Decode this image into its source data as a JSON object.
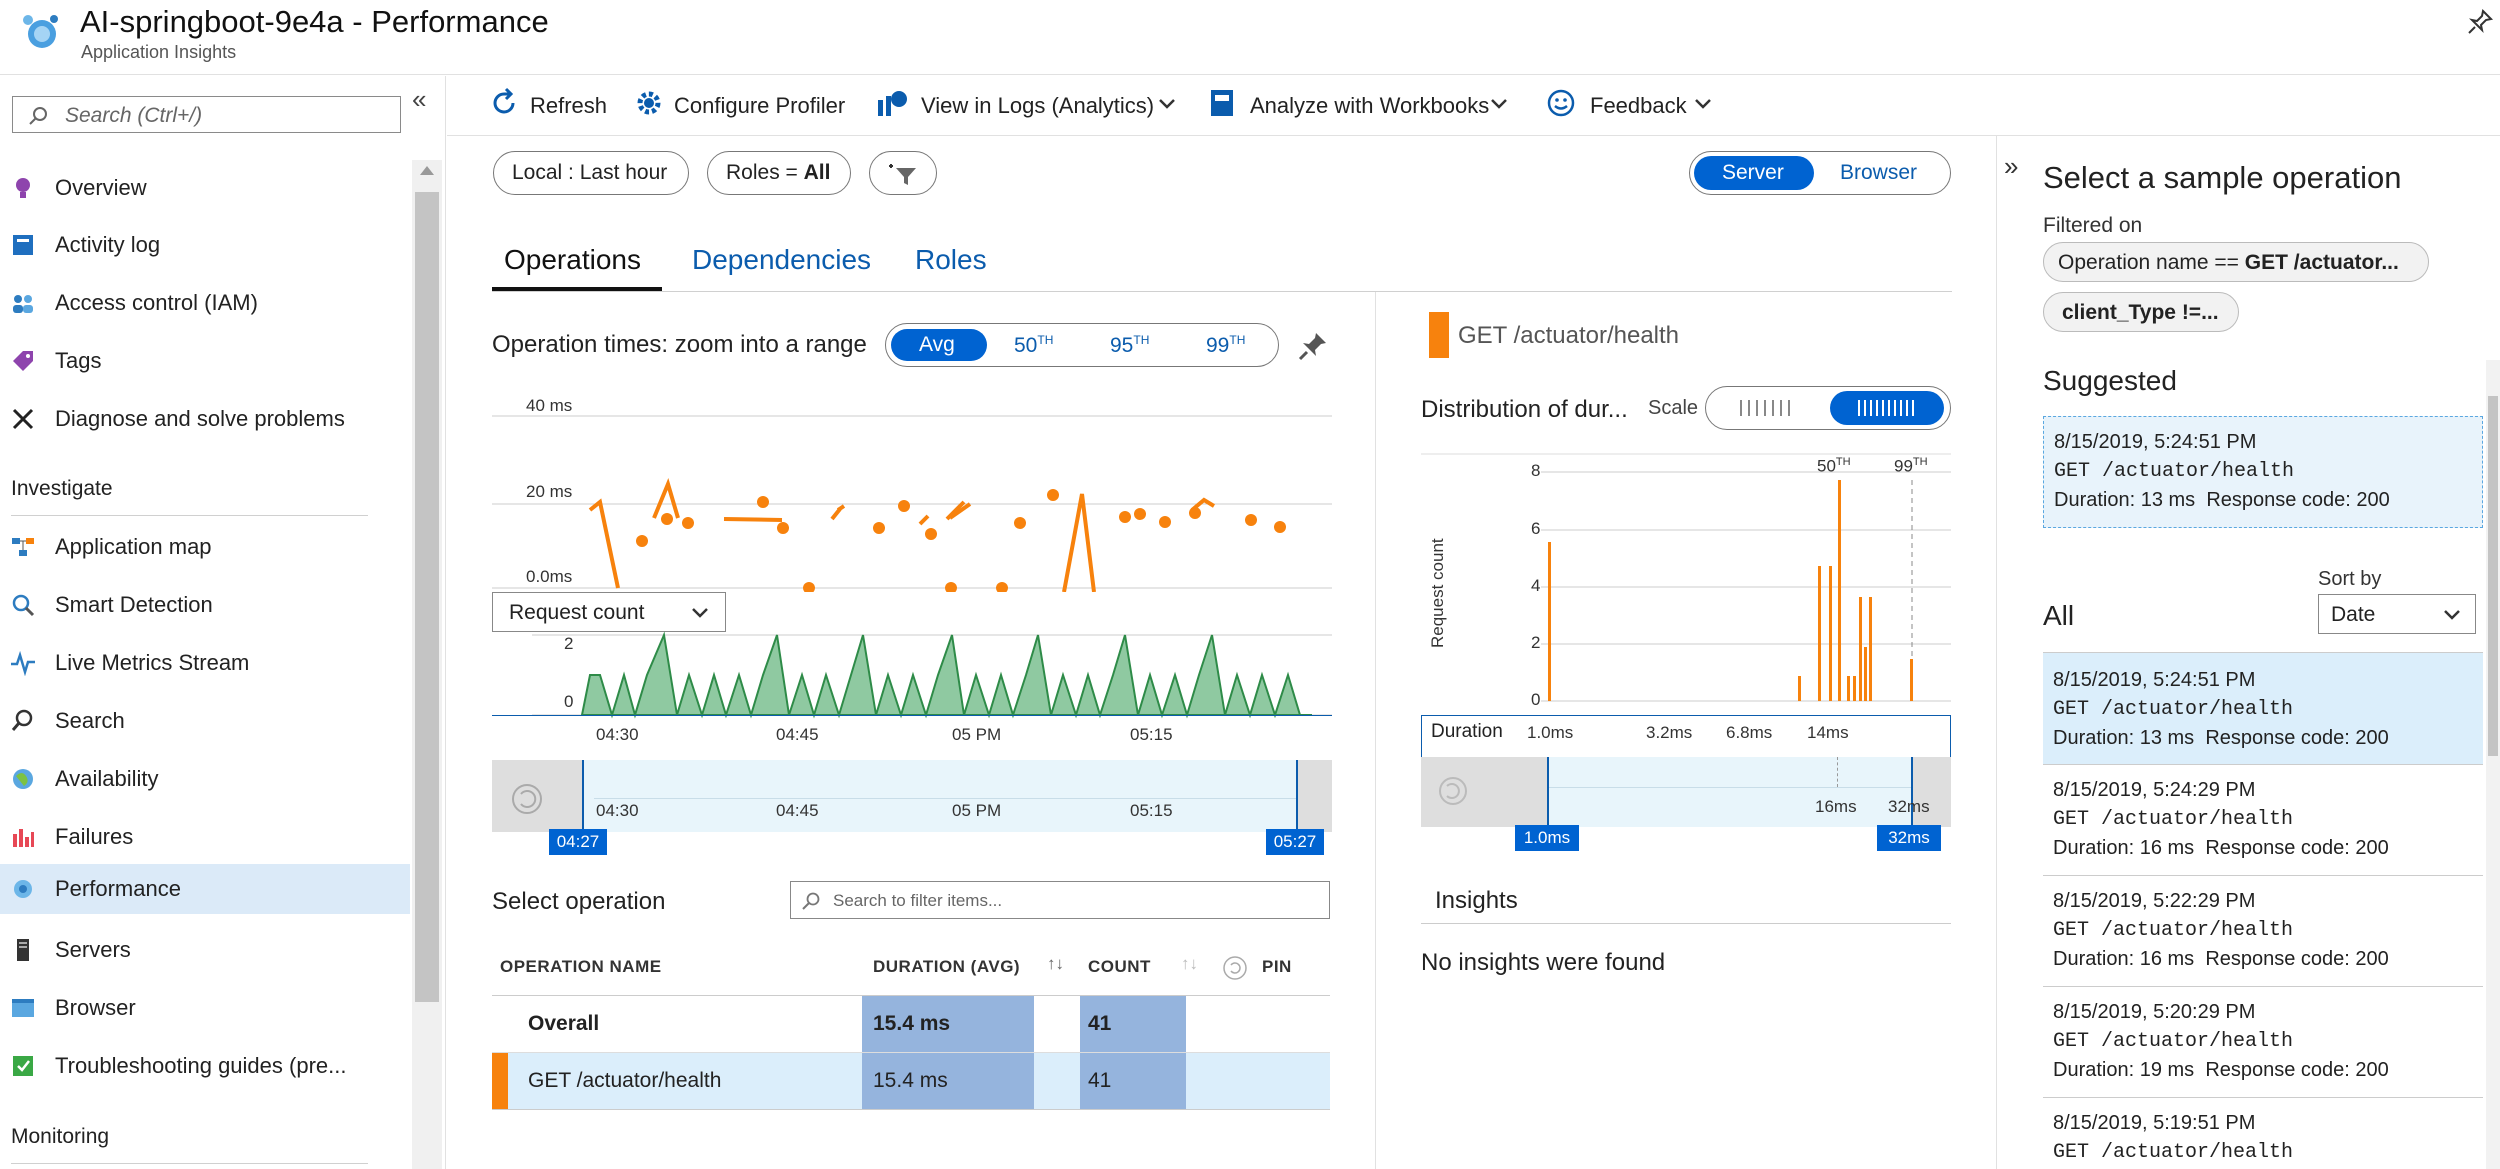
{
  "header": {
    "title": "AI-springboot-9e4a - Performance",
    "subtitle": "Application Insights"
  },
  "sidebar": {
    "search_placeholder": "Search (Ctrl+/)",
    "collapse_icon": "double-chevron-left-icon",
    "items": [
      {
        "label": "Overview",
        "icon": "lightbulb-icon"
      },
      {
        "label": "Activity log",
        "icon": "log-book-icon"
      },
      {
        "label": "Access control (IAM)",
        "icon": "people-icon"
      },
      {
        "label": "Tags",
        "icon": "tag-icon"
      },
      {
        "label": "Diagnose and solve problems",
        "icon": "wrench-icon"
      }
    ],
    "section_investigate": "Investigate",
    "investigate_items": [
      {
        "label": "Application map",
        "icon": "app-map-icon"
      },
      {
        "label": "Smart Detection",
        "icon": "smart-detection-icon"
      },
      {
        "label": "Live Metrics Stream",
        "icon": "pulse-icon"
      },
      {
        "label": "Search",
        "icon": "search-icon"
      },
      {
        "label": "Availability",
        "icon": "globe-icon"
      },
      {
        "label": "Failures",
        "icon": "failures-chart-icon"
      },
      {
        "label": "Performance",
        "icon": "performance-icon",
        "selected": true
      },
      {
        "label": "Servers",
        "icon": "server-icon"
      },
      {
        "label": "Browser",
        "icon": "browser-icon"
      },
      {
        "label": "Troubleshooting guides (pre...",
        "icon": "guide-icon"
      }
    ],
    "section_monitoring": "Monitoring"
  },
  "toolbar": {
    "refresh": "Refresh",
    "configure_profiler": "Configure Profiler",
    "view_in_logs": "View in Logs (Analytics)",
    "analyze_workbooks": "Analyze with Workbooks",
    "feedback": "Feedback"
  },
  "filters": {
    "time_range": "Local : Last hour",
    "roles_prefix": "Roles = ",
    "roles_value": "All",
    "server": "Server",
    "browser": "Browser"
  },
  "tabs": {
    "operations": "Operations",
    "dependencies": "Dependencies",
    "roles": "Roles"
  },
  "op_times": {
    "title": "Operation times: zoom into a range",
    "avg": "Avg",
    "p50": "50",
    "p95": "95",
    "p99": "99",
    "th": "TH",
    "y_labels": [
      "40 ms",
      "20 ms",
      "0.0ms"
    ],
    "metric_select": "Request count",
    "count_y_labels": [
      "2",
      "0"
    ],
    "x_labels": [
      "04:30",
      "04:45",
      "05 PM",
      "05:15"
    ],
    "range_start": "04:27",
    "range_end": "05:27"
  },
  "select_operation": {
    "title": "Select operation",
    "search_placeholder": "Search to filter items...",
    "col_name": "OPERATION NAME",
    "col_duration": "DURATION (AVG)",
    "col_count": "COUNT",
    "col_pin": "PIN",
    "rows": [
      {
        "name": "Overall",
        "duration": "15.4 ms",
        "count": "41"
      },
      {
        "name": "GET /actuator/health",
        "duration": "15.4 ms",
        "count": "41"
      }
    ]
  },
  "distribution": {
    "operation": "GET /actuator/health",
    "title": "Distribution of dur...",
    "scale": "Scale",
    "y_axis": "Request count",
    "y_labels": [
      "8",
      "6",
      "4",
      "2",
      "0"
    ],
    "p50": "50",
    "p99": "99",
    "th": "TH",
    "x_title": "Duration",
    "x_labels": [
      "1.0ms",
      "3.2ms",
      "6.8ms",
      "14ms"
    ],
    "range_labels": [
      "16ms",
      "32ms"
    ],
    "range_start": "1.0ms",
    "range_end": "32ms"
  },
  "insights": {
    "title": "Insights",
    "empty": "No insights were found"
  },
  "right_panel": {
    "title": "Select a sample operation",
    "filtered_on": "Filtered on",
    "filter1_prefix": "Operation name == ",
    "filter1_value": "GET /actuator...",
    "filter2": "client_Type !=...",
    "suggested": "Suggested",
    "suggested_card": {
      "date": "8/15/2019, 5:24:51 PM",
      "op": "GET /actuator/health",
      "duration_label": "Duration: ",
      "duration": "13 ms",
      "code_label": "Response code: ",
      "code": "200"
    },
    "all": "All",
    "sort_by": "Sort by",
    "sort_value": "Date",
    "cards": [
      {
        "date": "8/15/2019, 5:24:51 PM",
        "op": "GET /actuator/health",
        "duration": "13 ms",
        "code": "200"
      },
      {
        "date": "8/15/2019, 5:24:29 PM",
        "op": "GET /actuator/health",
        "duration": "16 ms",
        "code": "200"
      },
      {
        "date": "8/15/2019, 5:22:29 PM",
        "op": "GET /actuator/health",
        "duration": "16 ms",
        "code": "200"
      },
      {
        "date": "8/15/2019, 5:20:29 PM",
        "op": "GET /actuator/health",
        "duration": "19 ms",
        "code": "200"
      },
      {
        "date": "8/15/2019, 5:19:51 PM",
        "op": "GET /actuator/health",
        "duration": "",
        "code": ""
      }
    ]
  },
  "colors": {
    "accent": "#0063d1",
    "orange": "#f7820d",
    "green": "#2e8b48",
    "green_fill": "#8fc9a1",
    "bar_blue": "#95b4dd",
    "selected_row": "#dbeefb"
  }
}
